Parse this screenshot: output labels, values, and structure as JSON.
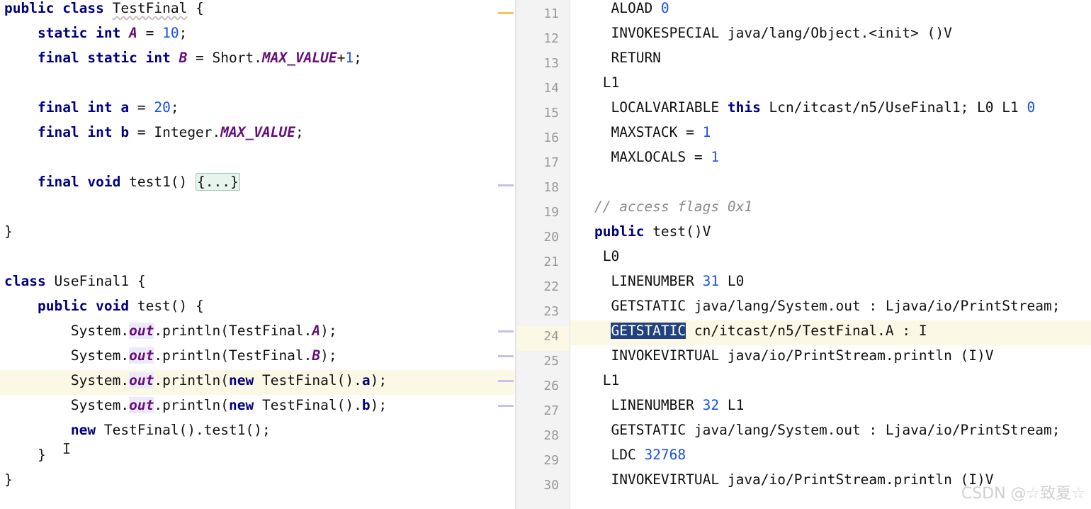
{
  "editor": {
    "lines": [
      [
        {
          "t": "public",
          "c": "kw"
        },
        {
          "t": " class ",
          "c": "kw-class"
        },
        {
          "t": "TestFinal",
          "c": "squig"
        },
        {
          "t": " {"
        }
      ],
      [
        {
          "t": "    "
        },
        {
          "t": "static int",
          "c": "kw"
        },
        {
          "t": " "
        },
        {
          "t": "A",
          "c": "fi"
        },
        {
          "t": " = "
        },
        {
          "t": "10",
          "c": "num-c"
        },
        {
          "t": ";"
        }
      ],
      [
        {
          "t": "    "
        },
        {
          "t": "final static int",
          "c": "kw"
        },
        {
          "t": " "
        },
        {
          "t": "B",
          "c": "fi"
        },
        {
          "t": " = Short."
        },
        {
          "t": "MAX_VALUE",
          "c": "fi"
        },
        {
          "t": "+"
        },
        {
          "t": "1",
          "c": "num-c"
        },
        {
          "t": ";"
        }
      ],
      [],
      [
        {
          "t": "    "
        },
        {
          "t": "final int",
          "c": "kw"
        },
        {
          "t": " "
        },
        {
          "t": "a",
          "c": "kw"
        },
        {
          "t": " = "
        },
        {
          "t": "20",
          "c": "num-c"
        },
        {
          "t": ";"
        }
      ],
      [
        {
          "t": "    "
        },
        {
          "t": "final int",
          "c": "kw"
        },
        {
          "t": " "
        },
        {
          "t": "b",
          "c": "kw"
        },
        {
          "t": " = Integer."
        },
        {
          "t": "MAX_VALUE",
          "c": "fi"
        },
        {
          "t": ";"
        }
      ],
      [],
      [
        {
          "t": "    "
        },
        {
          "t": "final void",
          "c": "kw"
        },
        {
          "t": " test1() "
        },
        {
          "t": "{...}",
          "c": "fold"
        }
      ],
      [],
      [
        {
          "t": "}"
        }
      ],
      [],
      [
        {
          "t": "class",
          "c": "kw"
        },
        {
          "t": " UseFinal1 {"
        }
      ],
      [
        {
          "t": "    "
        },
        {
          "t": "public void",
          "c": "kw"
        },
        {
          "t": " test() {"
        }
      ],
      [
        {
          "t": "        System."
        },
        {
          "t": "out",
          "c": "fi hl"
        },
        {
          "t": ".println(TestFinal."
        },
        {
          "t": "A",
          "c": "fi"
        },
        {
          "t": ");"
        }
      ],
      [
        {
          "t": "        System."
        },
        {
          "t": "out",
          "c": "fi hl"
        },
        {
          "t": ".println(TestFinal."
        },
        {
          "t": "B",
          "c": "fi"
        },
        {
          "t": ");"
        }
      ],
      [
        {
          "t": "        System."
        },
        {
          "t": "out",
          "c": "fi hl"
        },
        {
          "t": ".println("
        },
        {
          "t": "new",
          "c": "kw"
        },
        {
          "t": " TestFinal()."
        },
        {
          "t": "a",
          "c": "kw"
        },
        {
          "t": ");"
        }
      ],
      [
        {
          "t": "        System."
        },
        {
          "t": "out",
          "c": "fi hl"
        },
        {
          "t": ".println("
        },
        {
          "t": "new",
          "c": "kw"
        },
        {
          "t": " TestFinal()."
        },
        {
          "t": "b",
          "c": "kw"
        },
        {
          "t": ");"
        }
      ],
      [
        {
          "t": "        "
        },
        {
          "t": "new",
          "c": "kw"
        },
        {
          "t": " TestFinal().test1();"
        }
      ],
      [
        {
          "t": "    }"
        }
      ],
      [
        {
          "t": "}"
        }
      ]
    ],
    "current_line": 15
  },
  "bytecode": {
    "line_numbers": [
      "11",
      "12",
      "13",
      "14",
      "15",
      "16",
      "17",
      "18",
      "19",
      "20",
      "21",
      "22",
      "23",
      "24",
      "25",
      "26",
      "27",
      "28",
      "29",
      "30"
    ],
    "current_line": 13,
    "lines": [
      [
        {
          "t": "  ALOAD "
        },
        {
          "t": "0",
          "c": "num-c"
        }
      ],
      [
        {
          "t": "  INVOKESPECIAL java/lang/Object.<init> ()V"
        }
      ],
      [
        {
          "t": "  RETURN"
        }
      ],
      [
        {
          "t": " L1"
        }
      ],
      [
        {
          "t": "  LOCALVARIABLE "
        },
        {
          "t": "this",
          "c": "kw"
        },
        {
          "t": " Lcn/itcast/n5/UseFinal1; L0 L1 "
        },
        {
          "t": "0",
          "c": "num-c"
        }
      ],
      [
        {
          "t": "  MAXSTACK = "
        },
        {
          "t": "1",
          "c": "num-c"
        }
      ],
      [
        {
          "t": "  MAXLOCALS = "
        },
        {
          "t": "1",
          "c": "num-c"
        }
      ],
      [],
      [
        {
          "t": "// access flags 0x1",
          "c": "cm"
        }
      ],
      [
        {
          "t": "public",
          "c": "kw"
        },
        {
          "t": " test()V"
        }
      ],
      [
        {
          "t": " L0"
        }
      ],
      [
        {
          "t": "  LINENUMBER "
        },
        {
          "t": "31",
          "c": "num-c"
        },
        {
          "t": " L0"
        }
      ],
      [
        {
          "t": "  GETSTATIC java/lang/System.out : Ljava/io/PrintStream;"
        }
      ],
      [
        {
          "t": "  "
        },
        {
          "t": "GETSTATIC",
          "c": "sel"
        },
        {
          "t": " cn/itcast/n5/TestFinal.A : I"
        }
      ],
      [
        {
          "t": "  INVOKEVIRTUAL java/io/PrintStream.println (I)V"
        }
      ],
      [
        {
          "t": " L1"
        }
      ],
      [
        {
          "t": "  LINENUMBER "
        },
        {
          "t": "32",
          "c": "num-c"
        },
        {
          "t": " L1"
        }
      ],
      [
        {
          "t": "  GETSTATIC java/lang/System.out : Ljava/io/PrintStream;"
        }
      ],
      [
        {
          "t": "  LDC "
        },
        {
          "t": "32768",
          "c": "num-c"
        }
      ],
      [
        {
          "t": "  INVOKEVIRTUAL java/io/PrintStream.println (I)V"
        }
      ]
    ]
  },
  "watermark": "CSDN @☆致夏☆",
  "colors": {
    "keyword": "#000080",
    "static_field": "#660e7a",
    "number": "#1750eb",
    "comment": "#8c8c8c",
    "selection": "#21427d",
    "current_line": "#fcf8e6"
  }
}
